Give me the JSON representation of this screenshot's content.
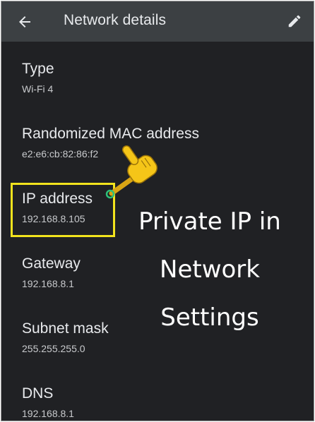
{
  "header": {
    "title": "Network details",
    "back_icon": "arrow-left-icon",
    "edit_icon": "pencil-icon"
  },
  "details": [
    {
      "label": "Type",
      "value": "Wi-Fi 4"
    },
    {
      "label": "Randomized MAC address",
      "value": "e2:e6:cb:82:86:f2"
    },
    {
      "label": "IP address",
      "value": "192.168.8.105"
    },
    {
      "label": "Gateway",
      "value": "192.168.8.1"
    },
    {
      "label": "Subnet mask",
      "value": "255.255.255.0"
    },
    {
      "label": "DNS",
      "value": "192.168.8.1"
    }
  ],
  "annotation": {
    "lines": [
      "Private IP in",
      "Network",
      "Settings"
    ],
    "highlight_color": "#f2e31d",
    "pointer_color": "#f5c518",
    "pointer_icon": "pointing-hand-icon"
  },
  "colors": {
    "background": "#202124",
    "app_bar": "#3c4043",
    "text_primary": "#e8eaed",
    "text_secondary": "#c8cacd"
  }
}
